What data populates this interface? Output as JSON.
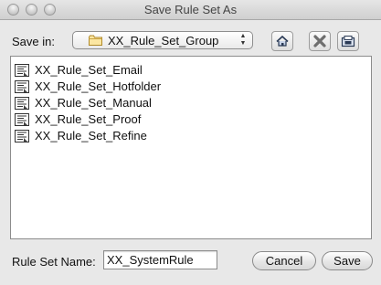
{
  "window": {
    "title": "Save Rule Set As"
  },
  "save_in": {
    "label": "Save in:",
    "selected_folder": "XX_Rule_Set_Group"
  },
  "toolbar": {
    "icons": [
      "home-icon",
      "delete-icon",
      "new-folder-icon"
    ]
  },
  "file_list": {
    "items": [
      "XX_Rule_Set_Email",
      "XX_Rule_Set_Hotfolder",
      "XX_Rule_Set_Manual",
      "XX_Rule_Set_Proof",
      "XX_Rule_Set_Refine"
    ]
  },
  "rule_set_name": {
    "label": "Rule Set Name:",
    "value": "XX_SystemRule"
  },
  "buttons": {
    "cancel": "Cancel",
    "save": "Save"
  }
}
